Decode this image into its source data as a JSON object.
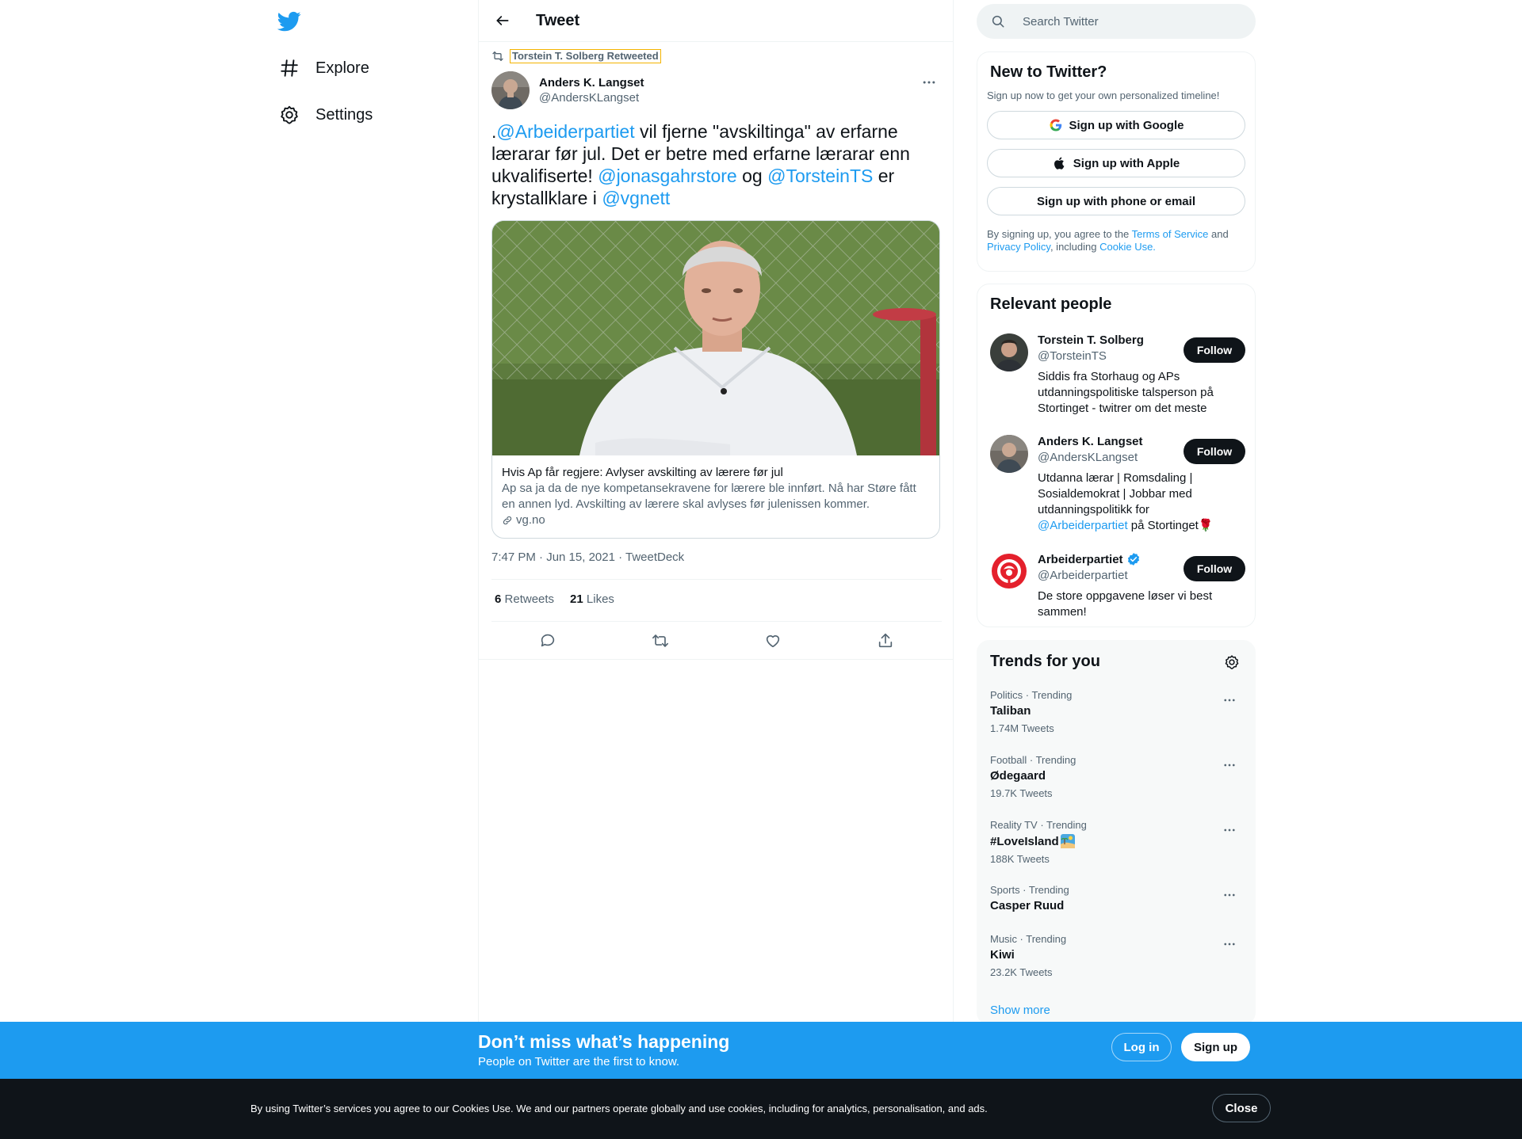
{
  "colors": {
    "accent": "#1d9bf0",
    "text": "#0f1419",
    "muted": "#536471",
    "follow_bg": "#0f1419"
  },
  "nav": {
    "logo_icon": "twitter-bird-icon",
    "items": [
      {
        "label": "Explore",
        "icon": "hashtag-icon"
      },
      {
        "label": "Settings",
        "icon": "gear-icon"
      }
    ]
  },
  "header": {
    "title": "Tweet",
    "back_icon": "arrow-left-icon"
  },
  "tweet": {
    "retweeted_by": "Torstein T. Solberg Retweeted",
    "author_name": "Anders K. Langset",
    "author_handle": "@AndersKLangset",
    "text_parts": {
      "p0": ".",
      "m1": "@Arbeiderpartiet",
      "p1": " vil fjerne \"avskiltinga\" av erfarne lærarar før jul. Det er betre med erfarne lærarar enn ukvalifiserte! ",
      "m2": "@jonasgahrstore",
      "p2": " og ",
      "m3": "@TorsteinTS",
      "p3": " er krystallklare i ",
      "m4": "@vgnett"
    },
    "card": {
      "title": "Hvis Ap får regjere: Avlyser avskilting av lærere før jul",
      "description": "Ap sa ja da de nye kompetansekravene for lærere ble innført. Nå har Støre fått en annen lyd. Avskilting av lærere skal avlyses før julenissen kommer.",
      "domain": "vg.no"
    },
    "meta": "7:47 PM · Jun 15, 2021 · TweetDeck",
    "retweets_count": "6",
    "retweets_label": "Retweets",
    "likes_count": "21",
    "likes_label": "Likes"
  },
  "search": {
    "placeholder": "Search Twitter"
  },
  "signup": {
    "title": "New to Twitter?",
    "subtitle": "Sign up now to get your own personalized timeline!",
    "google": "Sign up with Google",
    "apple": "Sign up with Apple",
    "phone": "Sign up with phone or email",
    "legal_1": "By signing up, you agree to the ",
    "terms": "Terms of Service",
    "legal_2": " and ",
    "privacy": "Privacy Policy",
    "legal_3": ", including ",
    "cookie": "Cookie Use."
  },
  "people": {
    "title": "Relevant people",
    "follow_label": "Follow",
    "list": [
      {
        "name": "Torstein T. Solberg",
        "handle": "@TorsteinTS",
        "bio": "Siddis fra Storhaug og APs utdanningspolitiske talsperson på Stortinget - twitrer om det meste"
      },
      {
        "name": "Anders K. Langset",
        "handle": "@AndersKLangset",
        "bio_1": "Utdanna lærar | Romsdaling | Sosialdemokrat | Jobbar med utdanningspolitikk for ",
        "bio_link": "@Arbeiderpartiet",
        "bio_2": " på Stortinget🌹"
      },
      {
        "name": "Arbeiderpartiet",
        "handle": "@Arbeiderpartiet",
        "bio": "De store oppgavene løser vi best sammen!",
        "verified": true
      }
    ]
  },
  "trends": {
    "title": "Trends for you",
    "list": [
      {
        "meta": "Politics · Trending",
        "name": "Taliban",
        "count": "1.74M Tweets"
      },
      {
        "meta": "Football · Trending",
        "name": "Ødegaard",
        "count": "19.7K Tweets"
      },
      {
        "meta": "Reality TV · Trending",
        "name": "#LoveIsland",
        "count": "188K Tweets"
      },
      {
        "meta": "Sports · Trending",
        "name": "Casper Ruud",
        "count": ""
      },
      {
        "meta": "Music · Trending",
        "name": "Kiwi",
        "count": "23.2K Tweets"
      }
    ],
    "show_more": "Show more"
  },
  "promo": {
    "title": "Don’t miss what’s happening",
    "subtitle": "People on Twitter are the first to know.",
    "login": "Log in",
    "signup": "Sign up"
  },
  "cookie_bar": {
    "text": "By using Twitter’s services you agree to our Cookies Use. We and our partners operate globally and use cookies, including for analytics, personalisation, and ads.",
    "close": "Close"
  }
}
